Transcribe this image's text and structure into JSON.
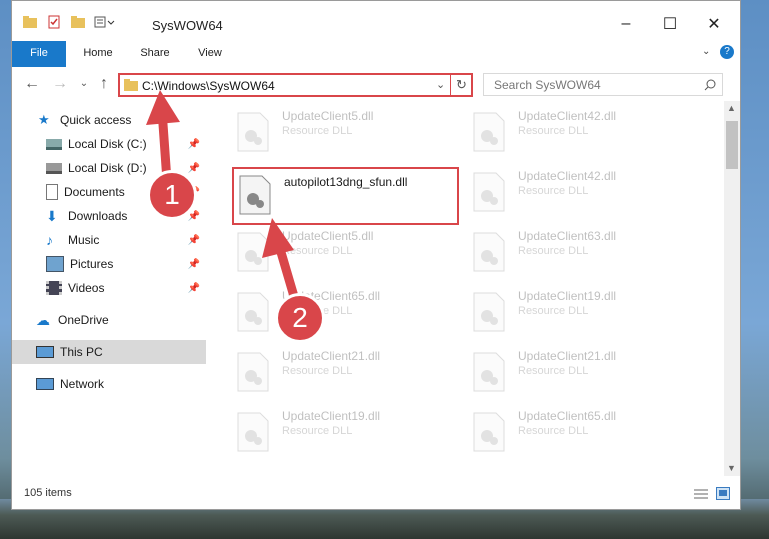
{
  "window": {
    "title": "SysWOW64",
    "tabs": {
      "file": "File",
      "home": "Home",
      "share": "Share",
      "view": "View"
    },
    "address": "C:\\Windows\\SysWOW64",
    "search_placeholder": "Search SysWOW64",
    "status": "105 items"
  },
  "sidebar": {
    "items": [
      {
        "label": "Quick access"
      },
      {
        "label": "Local Disk (C:)"
      },
      {
        "label": "Local Disk (D:)"
      },
      {
        "label": "Documents"
      },
      {
        "label": "Downloads"
      },
      {
        "label": "Music"
      },
      {
        "label": "Pictures"
      },
      {
        "label": "Videos"
      },
      {
        "label": "OneDrive"
      },
      {
        "label": "This PC"
      },
      {
        "label": "Network"
      }
    ]
  },
  "files": {
    "col1": [
      {
        "name": "UpdateClient5.dll",
        "type": "Resource DLL"
      },
      {
        "name": "autopilot13dng_sfun.dll",
        "type": ""
      },
      {
        "name": "UpdateClient5.dll",
        "type": "Resource DLL"
      },
      {
        "name": "UpdateClient65.dll",
        "type": "Resource DLL"
      },
      {
        "name": "UpdateClient21.dll",
        "type": "Resource DLL"
      },
      {
        "name": "UpdateClient19.dll",
        "type": "Resource DLL"
      }
    ],
    "col2": [
      {
        "name": "UpdateClient42.dll",
        "type": "Resource DLL"
      },
      {
        "name": "UpdateClient42.dll",
        "type": "Resource DLL"
      },
      {
        "name": "UpdateClient63.dll",
        "type": "Resource DLL"
      },
      {
        "name": "UpdateClient19.dll",
        "type": "Resource DLL"
      },
      {
        "name": "UpdateClient21.dll",
        "type": "Resource DLL"
      },
      {
        "name": "UpdateClient65.dll",
        "type": "Resource DLL"
      }
    ]
  },
  "badges": {
    "one": "1",
    "two": "2"
  },
  "colors": {
    "accent": "#1979ca",
    "highlight": "#d9464a"
  }
}
